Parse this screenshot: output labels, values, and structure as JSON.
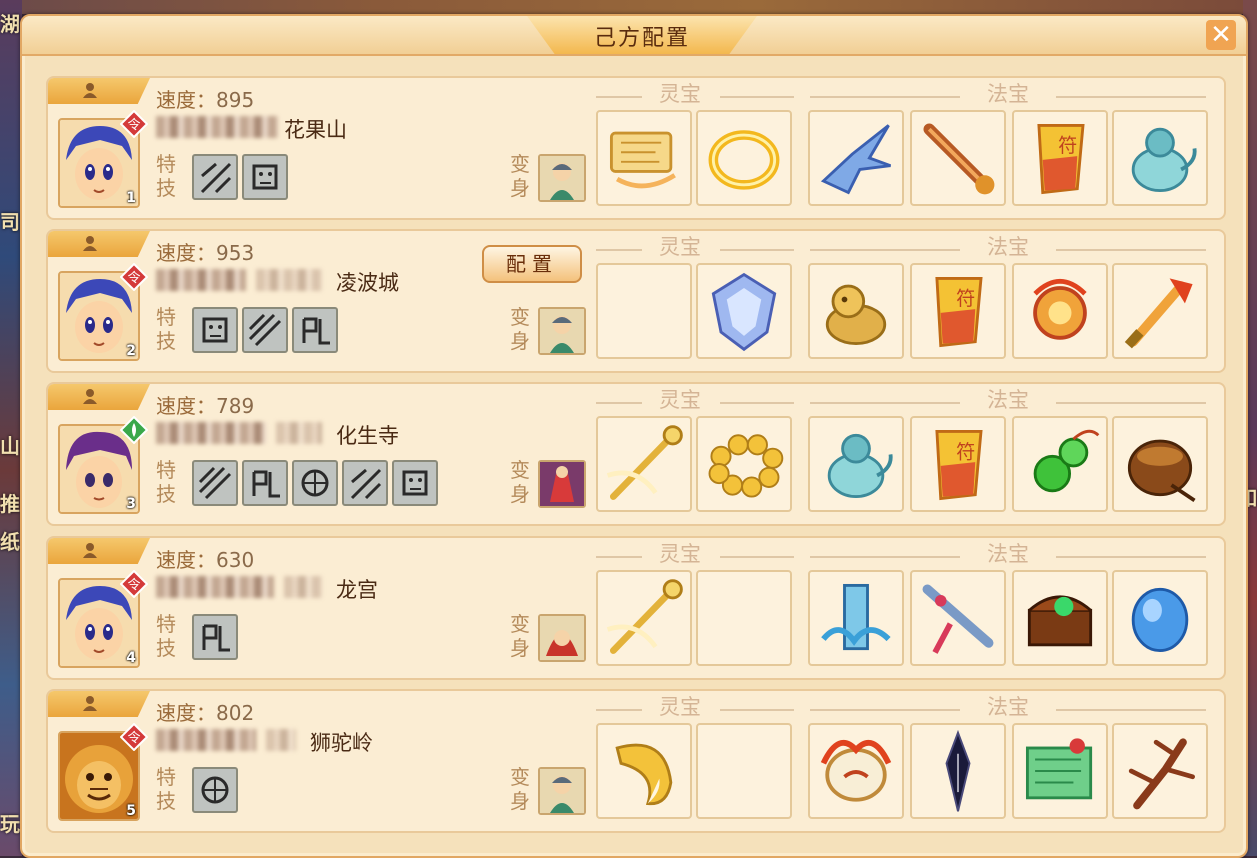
{
  "window": {
    "title": "己方配置",
    "close_label": "✕"
  },
  "background": {
    "left_glyphs": [
      "湖",
      "司",
      "山",
      "推",
      "纸",
      "玩"
    ],
    "right_glyphs": [
      "如"
    ]
  },
  "labels": {
    "speed_prefix": "速度：",
    "skills": "特技",
    "transform": "变身",
    "lingbao": "灵宝",
    "fabao": "法宝"
  },
  "rows": [
    {
      "index": "1",
      "speed": "895",
      "sect": "花果山",
      "sect_badge": "red",
      "avatar": "boy-blue-hair",
      "skills_count": 2,
      "config_button": null,
      "transform_icon": "green-man-icon",
      "lingbao": [
        "scroll-icon",
        "gold-ring-icon"
      ],
      "fabao": [
        "blue-bird-icon",
        "flute-icon",
        "talisman-icon",
        "jade-gourd-icon"
      ]
    },
    {
      "index": "2",
      "speed": "953",
      "sect": "凌波城",
      "sect_badge": "red",
      "avatar": "boy-blue-hair",
      "skills_count": 3,
      "config_button": "配置",
      "transform_icon": "green-man-icon",
      "lingbao": [
        null,
        "ice-shield-icon"
      ],
      "fabao": [
        "gold-lion-icon",
        "talisman-icon",
        "flame-orb-icon",
        "fire-sword-icon"
      ]
    },
    {
      "index": "3",
      "speed": "789",
      "sect": "化生寺",
      "sect_badge": "green",
      "avatar": "boy-purple-hair",
      "skills_count": 5,
      "config_button": null,
      "transform_icon": "red-robe-icon",
      "lingbao": [
        "gold-staff-icon",
        "gold-beads-icon"
      ],
      "fabao": [
        "jade-gourd-icon",
        "talisman-icon",
        "green-gourd-icon",
        "drum-pot-icon"
      ]
    },
    {
      "index": "4",
      "speed": "630",
      "sect": "龙宫",
      "sect_badge": "red",
      "avatar": "boy-blue-hair",
      "skills_count": 1,
      "config_button": null,
      "transform_icon": "red-hood-icon",
      "lingbao": [
        "gold-staff-icon",
        null
      ],
      "fabao": [
        "water-pillar-icon",
        "flute-tassel-icon",
        "treasure-chest-icon",
        "blue-stone-icon"
      ]
    },
    {
      "index": "5",
      "speed": "802",
      "sect": "狮驼岭",
      "sect_badge": "red",
      "avatar": "lion-demon",
      "skills_count": 1,
      "config_button": null,
      "transform_icon": "green-man-icon",
      "lingbao": [
        "gold-horn-icon",
        null
      ],
      "fabao": [
        "fire-drum-icon",
        "black-feather-icon",
        "green-scroll-icon",
        "branch-icon"
      ]
    }
  ]
}
